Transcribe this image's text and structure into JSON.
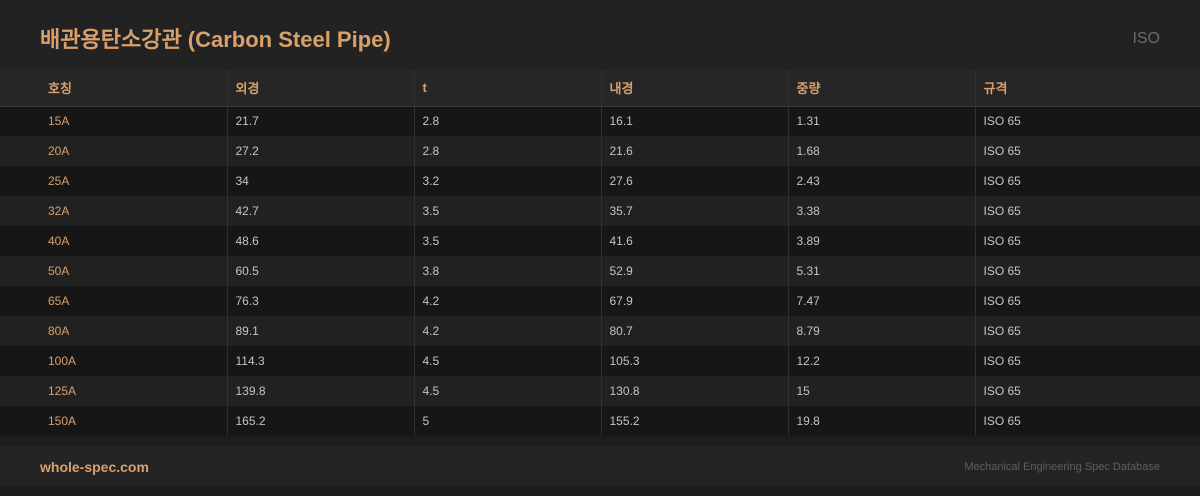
{
  "header": {
    "title": "배관용탄소강관 (Carbon Steel Pipe)",
    "standard_tag": "ISO"
  },
  "table": {
    "columns": [
      "호칭",
      "외경",
      "t",
      "내경",
      "중량",
      "규격"
    ],
    "rows": [
      [
        "15A",
        "21.7",
        "2.8",
        "16.1",
        "1.31",
        "ISO 65"
      ],
      [
        "20A",
        "27.2",
        "2.8",
        "21.6",
        "1.68",
        "ISO 65"
      ],
      [
        "25A",
        "34",
        "3.2",
        "27.6",
        "2.43",
        "ISO 65"
      ],
      [
        "32A",
        "42.7",
        "3.5",
        "35.7",
        "3.38",
        "ISO 65"
      ],
      [
        "40A",
        "48.6",
        "3.5",
        "41.6",
        "3.89",
        "ISO 65"
      ],
      [
        "50A",
        "60.5",
        "3.8",
        "52.9",
        "5.31",
        "ISO 65"
      ],
      [
        "65A",
        "76.3",
        "4.2",
        "67.9",
        "7.47",
        "ISO 65"
      ],
      [
        "80A",
        "89.1",
        "4.2",
        "80.7",
        "8.79",
        "ISO 65"
      ],
      [
        "100A",
        "114.3",
        "4.5",
        "105.3",
        "12.2",
        "ISO 65"
      ],
      [
        "125A",
        "139.8",
        "4.5",
        "130.8",
        "15",
        "ISO 65"
      ],
      [
        "150A",
        "165.2",
        "5",
        "155.2",
        "19.8",
        "ISO 65"
      ]
    ]
  },
  "footer": {
    "site": "whole-spec.com",
    "note": "Mechanical Engineering Spec Database"
  },
  "colors": {
    "accent": "#d7a06c",
    "background": "#1c1c1c",
    "text": "#c4c4c4"
  }
}
